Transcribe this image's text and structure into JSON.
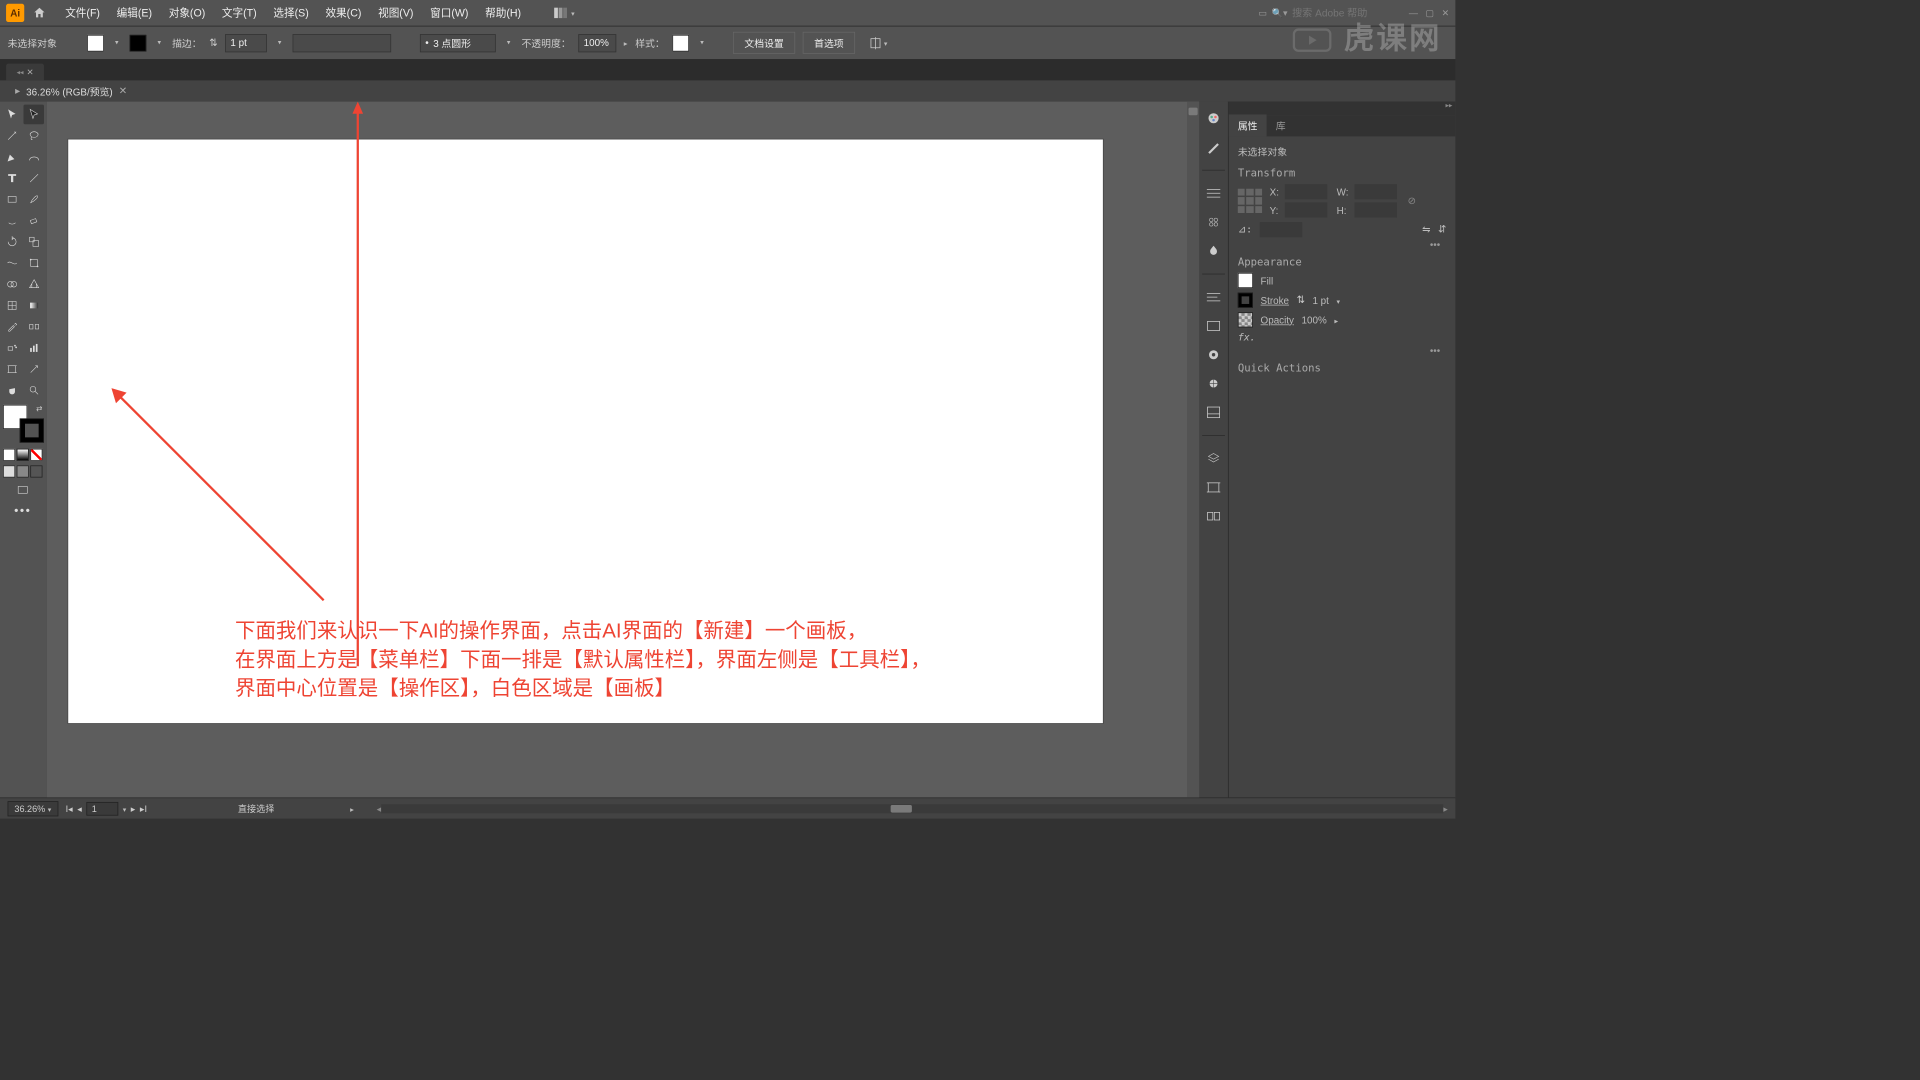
{
  "menu": {
    "items": [
      "文件(F)",
      "编辑(E)",
      "对象(O)",
      "文字(T)",
      "选择(S)",
      "效果(C)",
      "视图(V)",
      "窗口(W)",
      "帮助(H)"
    ],
    "search_placeholder": "搜索 Adobe 帮助"
  },
  "options": {
    "no_selection": "未选择对象",
    "stroke_label": "描边：",
    "stroke_val": "1 pt",
    "shape_label": "3 点圆形",
    "opacity_label": "不透明度：",
    "opacity_val": "100%",
    "style_label": "样式：",
    "btn_doc": "文档设置",
    "btn_pref": "首选项"
  },
  "doc": {
    "tab": "36.26% (RGB/预览)"
  },
  "annotation": {
    "line1": "下面我们来认识一下AI的操作界面，点击AI界面的【新建】一个画板，",
    "line2": "在界面上方是【菜单栏】下面一排是【默认属性栏】，界面左侧是【工具栏】，",
    "line3": "界面中心位置是【操作区】，白色区域是【画板】"
  },
  "panel": {
    "tab_props": "属性",
    "tab_lib": "库",
    "no_sel": "未选择对象",
    "transform": "Transform",
    "tf": {
      "x": "X:",
      "y": "Y:",
      "w": "W:",
      "h": "H:",
      "angle": "⊿:"
    },
    "appearance": "Appearance",
    "fill": "Fill",
    "stroke": "Stroke",
    "stroke_val": "1 pt",
    "opacity": "Opacity",
    "opacity_val": "100%",
    "fx": "fx.",
    "quick": "Quick Actions"
  },
  "status": {
    "zoom": "36.26%",
    "artboard": "1",
    "tool": "直接选择"
  },
  "watermark": "虎课网"
}
